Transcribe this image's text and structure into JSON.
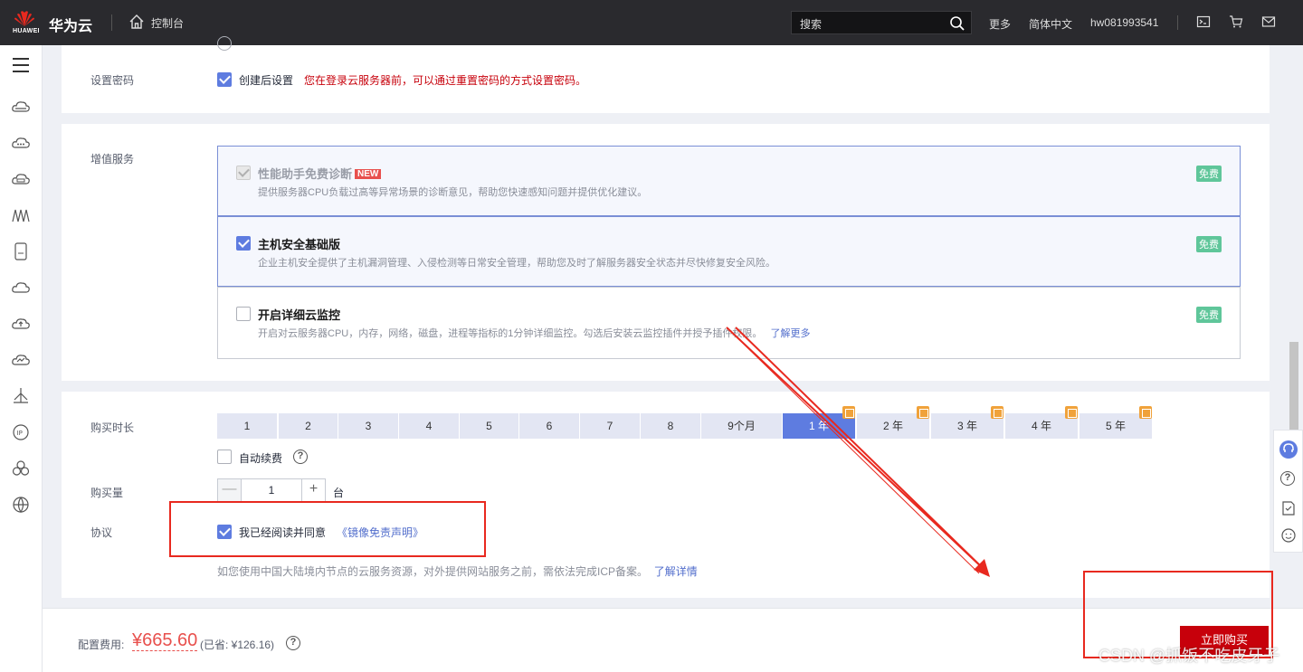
{
  "topbar": {
    "logo_text": "HUAWEI",
    "brand": "华为云",
    "console": "控制台",
    "search_placeholder": "搜索",
    "more": "更多",
    "language": "简体中文",
    "username": "hw081993541"
  },
  "password": {
    "label": "设置密码",
    "checkbox_label": "创建后设置",
    "hint": "您在登录云服务器前，可以通过重置密码的方式设置密码。"
  },
  "value_added": {
    "label": "增值服务",
    "items": [
      {
        "title": "性能助手免费诊断",
        "badge": "NEW",
        "desc": "提供服务器CPU负载过高等异常场景的诊断意见，帮助您快速感知问题并提供优化建议。",
        "price": "免费",
        "checked": true,
        "disabled": true
      },
      {
        "title": "主机安全基础版",
        "desc": "企业主机安全提供了主机漏洞管理、入侵检测等日常安全管理，帮助您及时了解服务器安全状态并尽快修复安全风险。",
        "price": "免费",
        "checked": true
      },
      {
        "title": "开启详细云监控",
        "desc": "开启对云服务器CPU，内存，网络，磁盘，进程等指标的1分钟详细监控。勾选后安装云监控插件并授予插件权限。",
        "link": "了解更多",
        "price": "免费",
        "checked": false
      }
    ]
  },
  "duration": {
    "label": "购买时长",
    "options": [
      "1",
      "2",
      "3",
      "4",
      "5",
      "6",
      "7",
      "8",
      "9个月",
      "1 年",
      "2 年",
      "3 年",
      "4 年",
      "5 年"
    ],
    "selected": "1 年",
    "auto_renew": "自动续费"
  },
  "quantity": {
    "label": "购买量",
    "value": "1",
    "unit": "台",
    "minus": "—",
    "plus": "+"
  },
  "agreement": {
    "label": "协议",
    "checkbox_label": "我已经阅读并同意",
    "link": "《镜像免责声明》",
    "notice": "如您使用中国大陆境内节点的云服务资源，对外提供网站服务之前，需依法完成ICP备案。",
    "notice_link": "了解详情"
  },
  "footer": {
    "fee_label": "配置费用:",
    "price": "¥665.60",
    "saved": "(已省: ¥126.16)",
    "buy_button": "立即购买"
  },
  "watermark": "CSDN @抓饭不吃皮牙子",
  "colors": {
    "accent": "#5e7ce0",
    "brand_red": "#c7000b",
    "price_red": "#e8504d",
    "free_green": "#5fc69a",
    "annotation_red": "#e8291f"
  }
}
